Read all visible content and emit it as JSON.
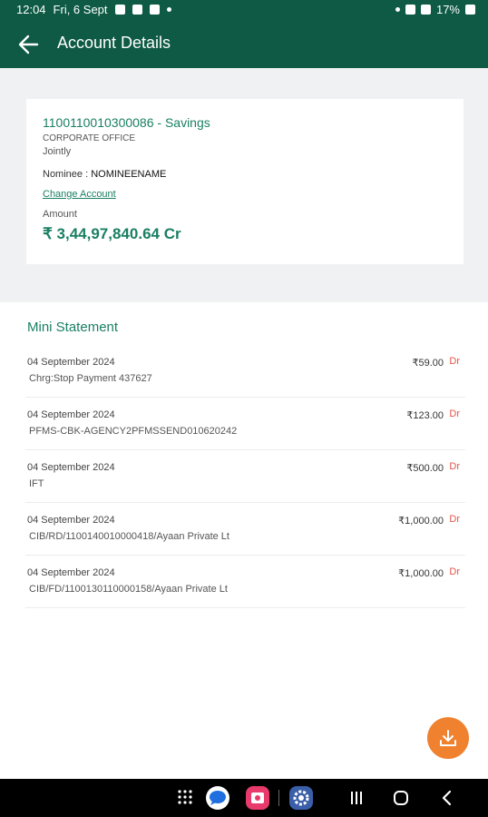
{
  "status": {
    "time": "12:04",
    "date": "Fri, 6 Sept",
    "battery": "17%"
  },
  "header": {
    "title": "Account Details"
  },
  "account": {
    "title": "1100110010300086 - Savings",
    "branch": "CORPORATE OFFICE",
    "holding": "Jointly",
    "nominee_label": "Nominee :",
    "nominee_value": "NOMINEENAME",
    "change_label": "Change Account",
    "amount_label": "Amount",
    "amount": "₹ 3,44,97,840.64 Cr"
  },
  "mini": {
    "title": "Mini Statement",
    "rows": [
      {
        "date": "04 September 2024",
        "desc": "Chrg:Stop Payment 437627",
        "amount": "₹59.00",
        "type": "Dr"
      },
      {
        "date": "04 September 2024",
        "desc": "PFMS-CBK-AGENCY2PFMSSEND010620242",
        "amount": "₹123.00",
        "type": "Dr"
      },
      {
        "date": "04 September 2024",
        "desc": "IFT",
        "amount": "₹500.00",
        "type": "Dr"
      },
      {
        "date": "04 September 2024",
        "desc": "CIB/RD/1100140010000418/Ayaan Private Lt",
        "amount": "₹1,000.00",
        "type": "Dr"
      },
      {
        "date": "04 September 2024",
        "desc": "CIB/FD/1100130110000158/Ayaan Private Lt",
        "amount": "₹1,000.00",
        "type": "Dr"
      }
    ]
  },
  "colors": {
    "brand": "#0e5a44",
    "accent": "#1a7f63",
    "debit": "#e55349",
    "fab": "#f0812f"
  },
  "icons": {
    "back": "arrow-left-icon",
    "download": "download-icon"
  }
}
